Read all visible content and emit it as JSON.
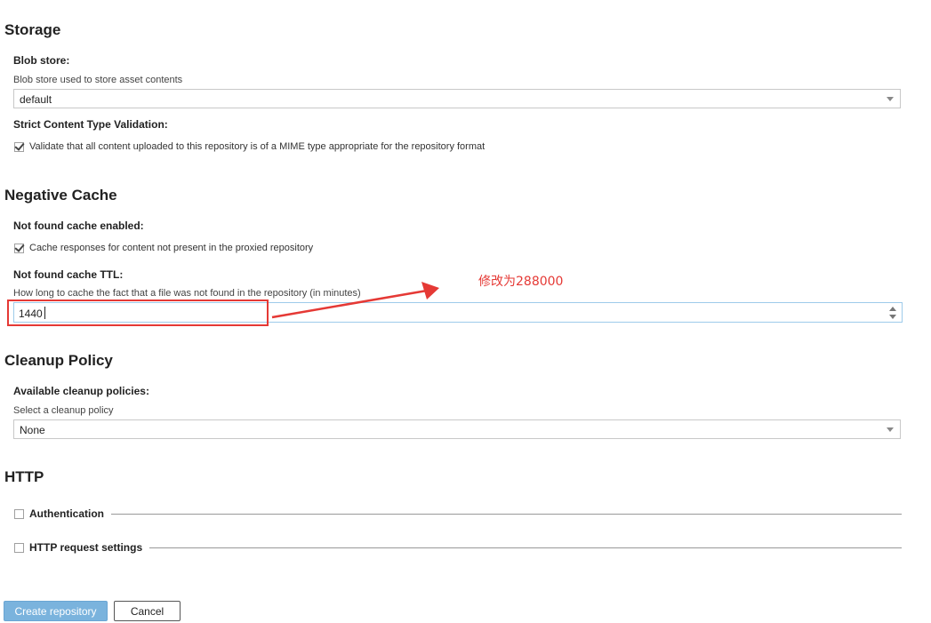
{
  "storage": {
    "title": "Storage",
    "blob_store_label": "Blob store:",
    "blob_store_help": "Blob store used to store asset contents",
    "blob_store_value": "default",
    "strict_label": "Strict Content Type Validation:",
    "strict_checkbox_text": "Validate that all content uploaded to this repository is of a MIME type appropriate for the repository format"
  },
  "negative_cache": {
    "title": "Negative Cache",
    "enabled_label": "Not found cache enabled:",
    "enabled_checkbox_text": "Cache responses for content not present in the proxied repository",
    "ttl_label": "Not found cache TTL:",
    "ttl_help": "How long to cache the fact that a file was not found in the repository (in minutes)",
    "ttl_value": "1440"
  },
  "annotation": {
    "text": "修改为288000",
    "color": "#e53935"
  },
  "cleanup": {
    "title": "Cleanup Policy",
    "label": "Available cleanup policies:",
    "help": "Select a cleanup policy",
    "value": "None"
  },
  "http": {
    "title": "HTTP",
    "authentication_label": "Authentication",
    "request_settings_label": "HTTP request settings"
  },
  "buttons": {
    "create_label": "Create repository",
    "cancel_label": "Cancel"
  },
  "icons": {
    "checkbox_checked": "checkmark-icon",
    "dropdown": "caret-down-icon",
    "spinner": "spinner-arrows-icon",
    "arrow": "red-arrow-icon"
  }
}
